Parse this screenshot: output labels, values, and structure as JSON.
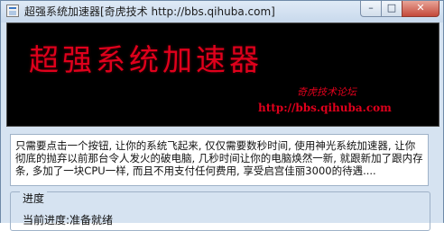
{
  "window": {
    "title": "超强系统加速器[奇虎技术 http://bbs.qihuba.com]",
    "controls": {
      "minimize": "–",
      "maximize": "□",
      "close": "✕"
    }
  },
  "banner": {
    "title": "超强系统加速器",
    "subtitle": "奇虎技术论坛",
    "url": "http://bbs.qihuba.com"
  },
  "description": "只需要点击一个按钮, 让你的系统飞起来, 仅仅需要数秒时间, 使用神光系统加速器, 让你彻底的抛弃以前那台令人发火的破电脑, 几秒时间让你的电脑焕然一新, 就跟新加了跟内存条, 多加了一块CPU一样, 而且不用支付任何费用, 享受启宫佳丽3000的待遇....",
  "progress": {
    "legend": "进度",
    "status": "当前进度:准备就绪"
  }
}
